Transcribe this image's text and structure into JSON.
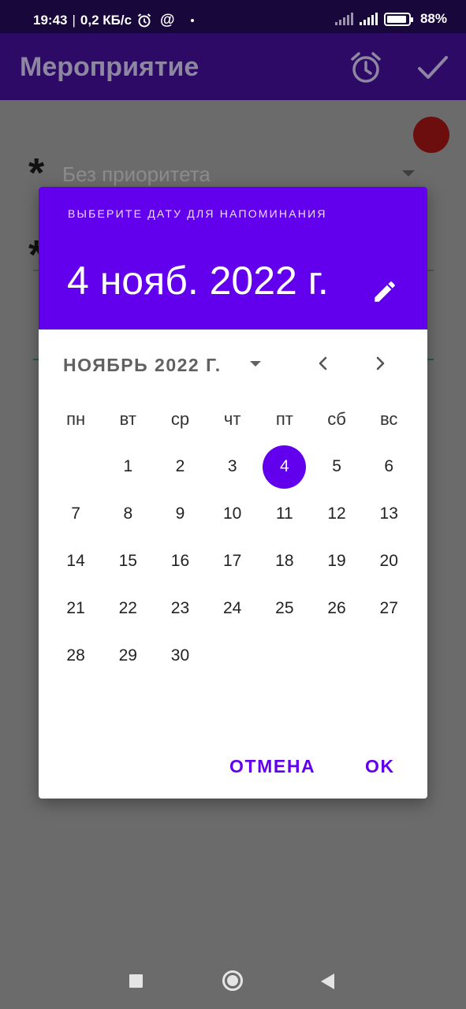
{
  "status_bar": {
    "time": "19:43",
    "network_speed": "0,2 КБ/с",
    "battery": "88%",
    "icons": [
      "alarm-icon",
      "at-icon",
      "signal-icon",
      "battery-icon"
    ]
  },
  "app_bar": {
    "title": "Мероприятие",
    "icons": [
      "alarm-icon",
      "check-icon"
    ]
  },
  "form": {
    "priority_placeholder": "Без приоритета",
    "required_marker": "*"
  },
  "dialog": {
    "caption": "ВЫБЕРИТЕ ДАТУ ДЛЯ НАПОМИНАНИЯ",
    "selected_date": "4 нояб. 2022 г.",
    "month_label": "НОЯБРЬ 2022 Г.",
    "weekdays": [
      "пн",
      "вт",
      "ср",
      "чт",
      "пт",
      "сб",
      "вс"
    ],
    "weeks": [
      [
        "",
        "1",
        "2",
        "3",
        "4",
        "5",
        "6"
      ],
      [
        "7",
        "8",
        "9",
        "10",
        "11",
        "12",
        "13"
      ],
      [
        "14",
        "15",
        "16",
        "17",
        "18",
        "19",
        "20"
      ],
      [
        "21",
        "22",
        "23",
        "24",
        "25",
        "26",
        "27"
      ],
      [
        "28",
        "29",
        "30",
        "",
        "",
        "",
        ""
      ]
    ],
    "selected_day": "4",
    "cancel_label": "ОТМЕНА",
    "ok_label": "OK"
  },
  "colors": {
    "accent": "#6200ee",
    "app_bar": "#2c0a66",
    "status_bar": "#17073a",
    "scrim": "#6b6b6b"
  }
}
